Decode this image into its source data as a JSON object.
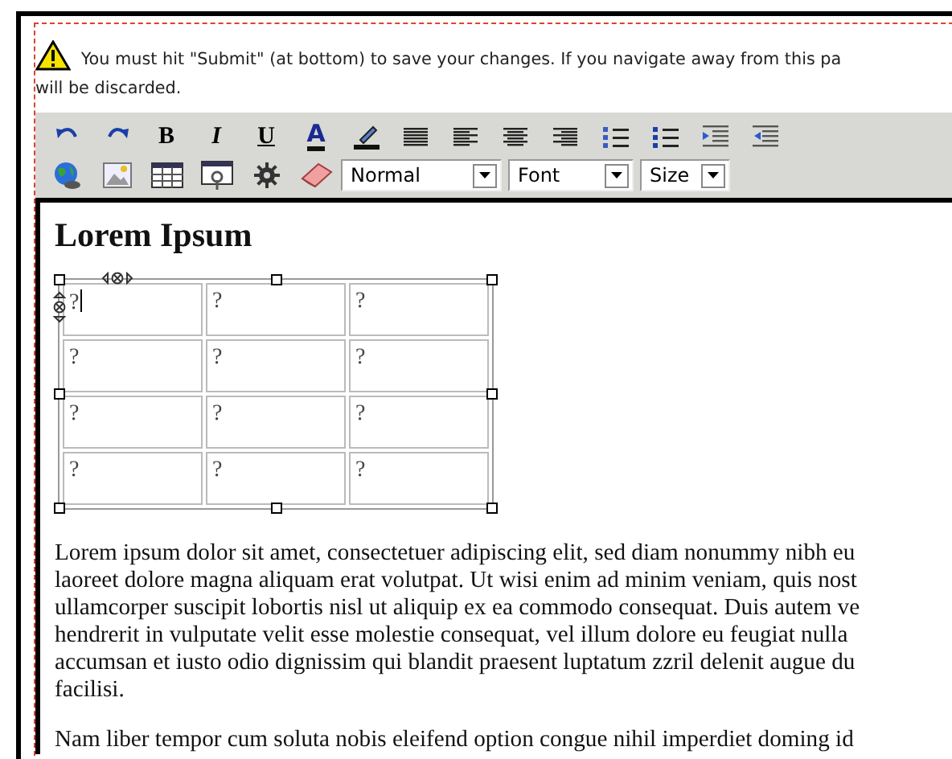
{
  "warning": {
    "lines": [
      "You must hit \"Submit\" (at bottom) to save your changes. If you navigate away from this pa",
      "will be discarded."
    ]
  },
  "toolbar": {
    "row_1": [
      {
        "kind": "undo"
      },
      {
        "kind": "redo"
      },
      {
        "kind": "bold",
        "label": "B"
      },
      {
        "kind": "italic",
        "label": "I"
      },
      {
        "kind": "underline",
        "label": "U"
      },
      {
        "kind": "font-color",
        "label": "A"
      },
      {
        "kind": "highlight"
      },
      {
        "kind": "justify"
      },
      {
        "kind": "align-left"
      },
      {
        "kind": "align-center"
      },
      {
        "kind": "align-right"
      },
      {
        "kind": "ordered-list"
      },
      {
        "kind": "bullet-list"
      },
      {
        "kind": "indent"
      },
      {
        "kind": "outdent"
      }
    ],
    "row_2": [
      {
        "kind": "link"
      },
      {
        "kind": "image"
      },
      {
        "kind": "table"
      },
      {
        "kind": "form"
      },
      {
        "kind": "gear"
      },
      {
        "kind": "eraser"
      }
    ],
    "selects": [
      {
        "value": "Normal"
      },
      {
        "value": "Font"
      },
      {
        "value": "Size"
      }
    ]
  },
  "editor": {
    "heading": "Lorem Ipsum",
    "table": {
      "rows": [
        [
          "?",
          "?",
          "?"
        ],
        [
          "?",
          "?",
          "?"
        ],
        [
          "?",
          "?",
          "?"
        ],
        [
          "?",
          "?",
          "?"
        ]
      ]
    },
    "paragraphs": [
      [
        "Lorem ipsum dolor sit amet, consectetuer adipiscing elit, sed diam nonummy nibh eu",
        "laoreet dolore magna aliquam erat volutpat. Ut wisi enim ad minim veniam, quis nost",
        "ullamcorper suscipit lobortis nisl ut aliquip ex ea commodo consequat. Duis autem ve",
        "hendrerit in vulputate velit esse molestie consequat, vel illum dolore eu feugiat nulla",
        "accumsan et iusto odio dignissim qui blandit praesent luptatum zzril delenit augue du",
        "facilisi."
      ],
      [
        "Nam liber tempor cum soluta nobis eleifend option congue nihil imperdiet doming id"
      ]
    ]
  }
}
